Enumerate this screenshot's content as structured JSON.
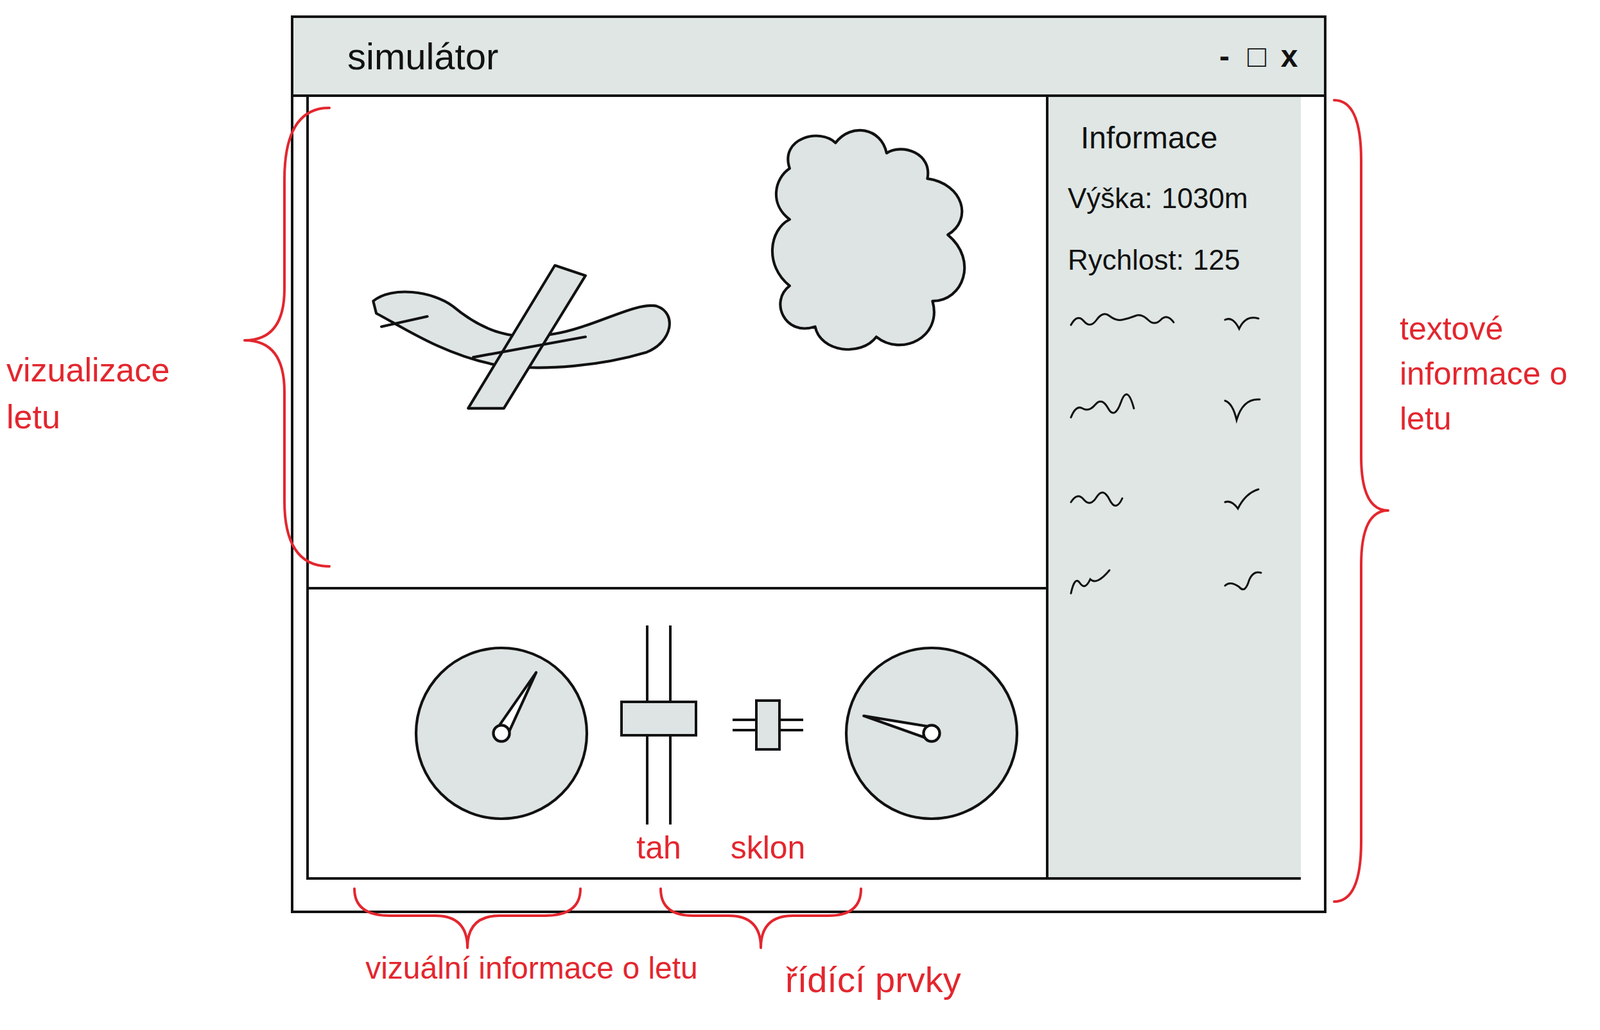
{
  "window": {
    "title": "simulátor",
    "controls": [
      "-",
      "□",
      "x"
    ]
  },
  "info_panel": {
    "title": "Informace",
    "rows": [
      {
        "label": "Výška:",
        "value": "1030m"
      },
      {
        "label": "Rychlost:",
        "value": "125"
      }
    ],
    "placeholder_rows": [
      {
        "kind": "squiggle"
      },
      {
        "kind": "squiggle"
      },
      {
        "kind": "squiggle"
      },
      {
        "kind": "squiggle"
      }
    ]
  },
  "gauges": [
    {
      "level": 0.61
    },
    {
      "level": 0.22
    }
  ],
  "controls": [
    {
      "label": "tah",
      "kind": "vertical",
      "level": 0.54
    },
    {
      "label": "sklon",
      "kind": "horizontal",
      "level": 0.5
    }
  ],
  "annotations": {
    "visualization": "vizualizace letu",
    "text_info": "textové informace o letu",
    "visual_info": "vizuální informace o letu",
    "controls": "řídící prvky"
  }
}
